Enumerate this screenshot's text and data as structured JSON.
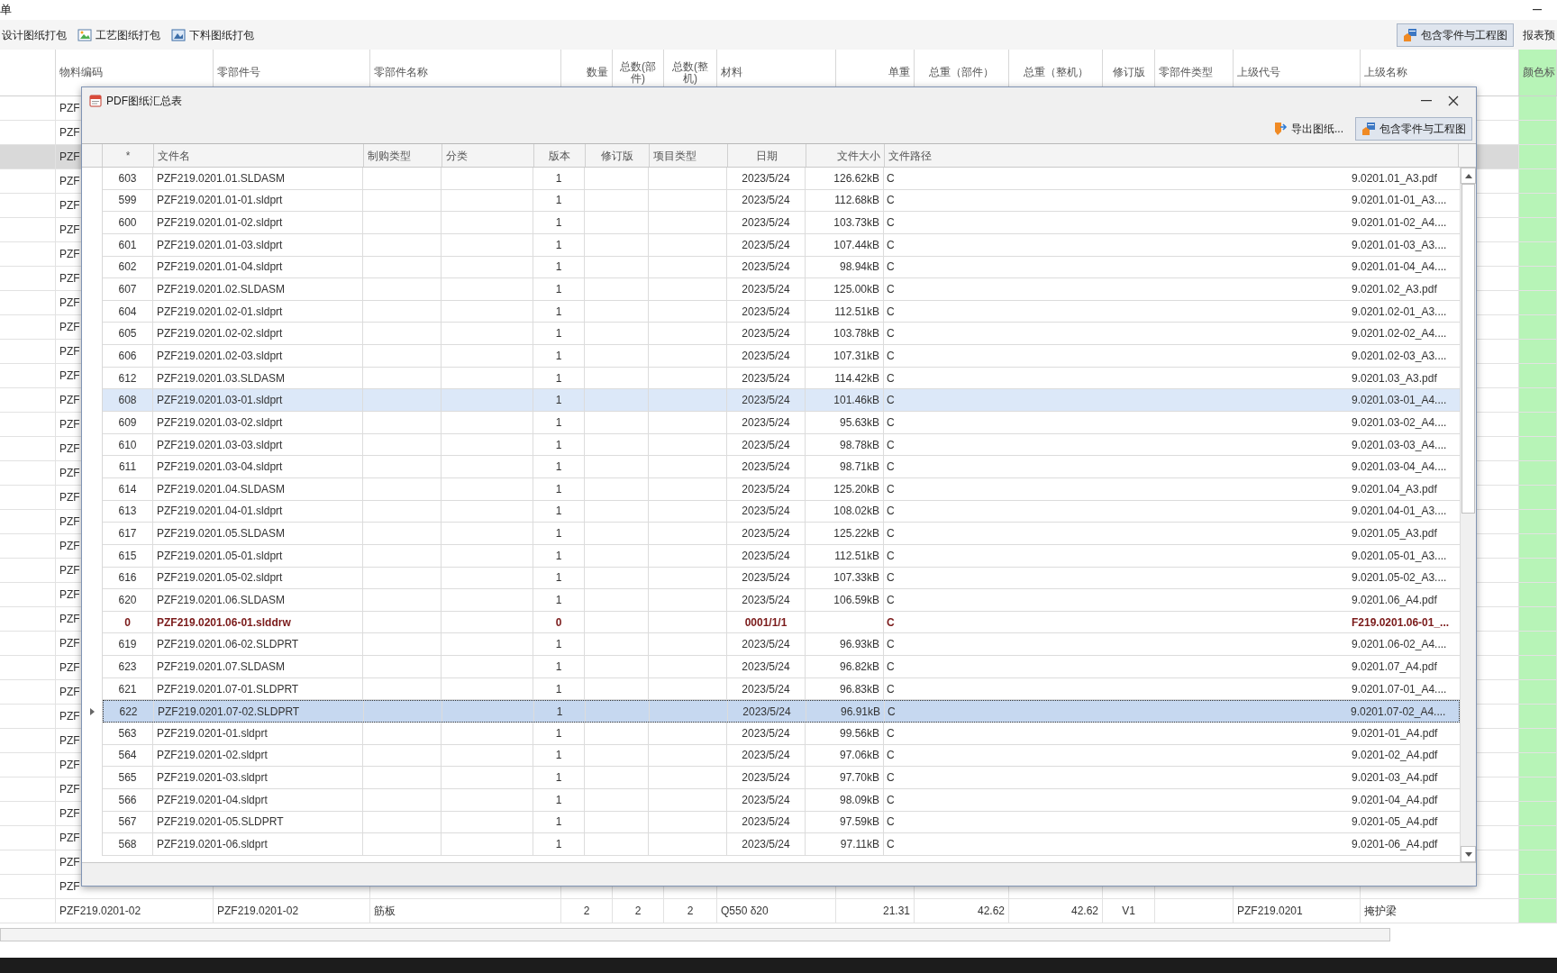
{
  "window": {
    "title": "单"
  },
  "toolbar": {
    "buttons": [
      {
        "label": "设计图纸打包",
        "kind": "text"
      },
      {
        "label": "工艺图纸打包",
        "kind": "process"
      },
      {
        "label": "下料图纸打包",
        "kind": "cutting"
      }
    ],
    "right": [
      {
        "label": "包含零件与工程图",
        "pressed": true
      },
      {
        "label": "报表预",
        "pressed": false
      }
    ]
  },
  "table": {
    "columns": [
      "物料编码",
      "零部件号",
      "零部件名称",
      "数量",
      "总数(部件)",
      "总数(整机)",
      "材料",
      "单重",
      "总重（部件）",
      "总重（整机）",
      "修订版",
      "零部件类型",
      "上级代号",
      "上级名称",
      "颜色标"
    ],
    "rows": [
      {
        "cells": [
          "PZF"
        ],
        "selected": false
      },
      {
        "cells": [
          "PZF"
        ],
        "selected": false
      },
      {
        "cells": [
          "PZF"
        ],
        "selected": true
      },
      {
        "cells": [
          "PZF"
        ],
        "selected": false
      },
      {
        "cells": [
          "PZF"
        ],
        "selected": false
      },
      {
        "cells": [
          "PZF"
        ],
        "selected": false
      },
      {
        "cells": [
          "PZF"
        ],
        "selected": false
      },
      {
        "cells": [
          "PZF"
        ],
        "selected": false
      },
      {
        "cells": [
          "PZF"
        ],
        "selected": false
      },
      {
        "cells": [
          "PZF"
        ],
        "selected": false
      },
      {
        "cells": [
          "PZF"
        ],
        "selected": false
      },
      {
        "cells": [
          "PZF"
        ],
        "selected": false
      },
      {
        "cells": [
          "PZF"
        ],
        "selected": false
      },
      {
        "cells": [
          "PZF"
        ],
        "selected": false
      },
      {
        "cells": [
          "PZF"
        ],
        "selected": false
      },
      {
        "cells": [
          "PZF"
        ],
        "selected": false
      },
      {
        "cells": [
          "PZF"
        ],
        "selected": false
      },
      {
        "cells": [
          "PZF"
        ],
        "selected": false
      },
      {
        "cells": [
          "PZF"
        ],
        "selected": false
      },
      {
        "cells": [
          "PZF"
        ],
        "selected": false
      },
      {
        "cells": [
          "PZF"
        ],
        "selected": false
      },
      {
        "cells": [
          "PZF"
        ],
        "selected": false
      },
      {
        "cells": [
          "PZF"
        ],
        "selected": false
      },
      {
        "cells": [
          "PZF"
        ],
        "selected": false
      },
      {
        "cells": [
          "PZF"
        ],
        "selected": false
      },
      {
        "cells": [
          "PZF"
        ],
        "selected": false
      },
      {
        "cells": [
          "PZF"
        ],
        "selected": false
      },
      {
        "cells": [
          "PZF"
        ],
        "selected": false
      },
      {
        "cells": [
          "PZF"
        ],
        "selected": false
      },
      {
        "cells": [
          "PZF"
        ],
        "selected": false
      },
      {
        "cells": [
          "PZF"
        ],
        "selected": false
      },
      {
        "cells": [
          "PZF"
        ],
        "selected": false
      },
      {
        "cells": [
          "PZF"
        ],
        "selected": false
      },
      {
        "cells": [
          "PZF219.0201-02",
          "PZF219.0201-02",
          "筋板",
          "2",
          "2",
          "2",
          "Q550 δ20",
          "21.31",
          "42.62",
          "42.62",
          "V1",
          "",
          "PZF219.0201",
          "掩护梁"
        ],
        "selected": false
      }
    ]
  },
  "dialog": {
    "title": "PDF图纸汇总表",
    "toolbar": [
      {
        "label": "导出图纸...",
        "kind": "export",
        "pressed": false
      },
      {
        "label": "包含零件与工程图",
        "kind": "include",
        "pressed": true
      }
    ],
    "columns": [
      "*",
      "文件名",
      "制购类型",
      "分类",
      "版本",
      "修订版",
      "项目类型",
      "日期",
      "文件大小",
      "文件路径"
    ],
    "rows": [
      {
        "no": "603",
        "file": "PZF219.0201.01.SLDASM",
        "version": "1",
        "date": "2023/5/24",
        "size": "126.62kB",
        "path": "C",
        "path_tail": "9.0201.01_A3.pdf",
        "kind": "normal",
        "selected": false,
        "current": false
      },
      {
        "no": "599",
        "file": "PZF219.0201.01-01.sldprt",
        "version": "1",
        "date": "2023/5/24",
        "size": "112.68kB",
        "path": "C",
        "path_tail": "9.0201.01-01_A3....",
        "kind": "normal",
        "selected": false,
        "current": false
      },
      {
        "no": "600",
        "file": "PZF219.0201.01-02.sldprt",
        "version": "1",
        "date": "2023/5/24",
        "size": "103.73kB",
        "path": "C",
        "path_tail": "9.0201.01-02_A4....",
        "kind": "normal",
        "selected": false,
        "current": false
      },
      {
        "no": "601",
        "file": "PZF219.0201.01-03.sldprt",
        "version": "1",
        "date": "2023/5/24",
        "size": "107.44kB",
        "path": "C",
        "path_tail": "9.0201.01-03_A3....",
        "kind": "normal",
        "selected": false,
        "current": false
      },
      {
        "no": "602",
        "file": "PZF219.0201.01-04.sldprt",
        "version": "1",
        "date": "2023/5/24",
        "size": "98.94kB",
        "path": "C",
        "path_tail": "9.0201.01-04_A4....",
        "kind": "normal",
        "selected": false,
        "current": false
      },
      {
        "no": "607",
        "file": "PZF219.0201.02.SLDASM",
        "version": "1",
        "date": "2023/5/24",
        "size": "125.00kB",
        "path": "C",
        "path_tail": "9.0201.02_A3.pdf",
        "kind": "normal",
        "selected": false,
        "current": false
      },
      {
        "no": "604",
        "file": "PZF219.0201.02-01.sldprt",
        "version": "1",
        "date": "2023/5/24",
        "size": "112.51kB",
        "path": "C",
        "path_tail": "9.0201.02-01_A3....",
        "kind": "normal",
        "selected": false,
        "current": false
      },
      {
        "no": "605",
        "file": "PZF219.0201.02-02.sldprt",
        "version": "1",
        "date": "2023/5/24",
        "size": "103.78kB",
        "path": "C",
        "path_tail": "9.0201.02-02_A4....",
        "kind": "normal",
        "selected": false,
        "current": false
      },
      {
        "no": "606",
        "file": "PZF219.0201.02-03.sldprt",
        "version": "1",
        "date": "2023/5/24",
        "size": "107.31kB",
        "path": "C",
        "path_tail": "9.0201.02-03_A3....",
        "kind": "normal",
        "selected": false,
        "current": false
      },
      {
        "no": "612",
        "file": "PZF219.0201.03.SLDASM",
        "version": "1",
        "date": "2023/5/24",
        "size": "114.42kB",
        "path": "C",
        "path_tail": "9.0201.03_A3.pdf",
        "kind": "normal",
        "selected": false,
        "current": false
      },
      {
        "no": "608",
        "file": "PZF219.0201.03-01.sldprt",
        "version": "1",
        "date": "2023/5/24",
        "size": "101.46kB",
        "path": "C",
        "path_tail": "9.0201.03-01_A4....",
        "kind": "normal",
        "selected": true,
        "current": false
      },
      {
        "no": "609",
        "file": "PZF219.0201.03-02.sldprt",
        "version": "1",
        "date": "2023/5/24",
        "size": "95.63kB",
        "path": "C",
        "path_tail": "9.0201.03-02_A4....",
        "kind": "normal",
        "selected": false,
        "current": false
      },
      {
        "no": "610",
        "file": "PZF219.0201.03-03.sldprt",
        "version": "1",
        "date": "2023/5/24",
        "size": "98.78kB",
        "path": "C",
        "path_tail": "9.0201.03-03_A4....",
        "kind": "normal",
        "selected": false,
        "current": false
      },
      {
        "no": "611",
        "file": "PZF219.0201.03-04.sldprt",
        "version": "1",
        "date": "2023/5/24",
        "size": "98.71kB",
        "path": "C",
        "path_tail": "9.0201.03-04_A4....",
        "kind": "normal",
        "selected": false,
        "current": false
      },
      {
        "no": "614",
        "file": "PZF219.0201.04.SLDASM",
        "version": "1",
        "date": "2023/5/24",
        "size": "125.20kB",
        "path": "C",
        "path_tail": "9.0201.04_A3.pdf",
        "kind": "normal",
        "selected": false,
        "current": false
      },
      {
        "no": "613",
        "file": "PZF219.0201.04-01.sldprt",
        "version": "1",
        "date": "2023/5/24",
        "size": "108.02kB",
        "path": "C",
        "path_tail": "9.0201.04-01_A3....",
        "kind": "normal",
        "selected": false,
        "current": false
      },
      {
        "no": "617",
        "file": "PZF219.0201.05.SLDASM",
        "version": "1",
        "date": "2023/5/24",
        "size": "125.22kB",
        "path": "C",
        "path_tail": "9.0201.05_A3.pdf",
        "kind": "normal",
        "selected": false,
        "current": false
      },
      {
        "no": "615",
        "file": "PZF219.0201.05-01.sldprt",
        "version": "1",
        "date": "2023/5/24",
        "size": "112.51kB",
        "path": "C",
        "path_tail": "9.0201.05-01_A3....",
        "kind": "normal",
        "selected": false,
        "current": false
      },
      {
        "no": "616",
        "file": "PZF219.0201.05-02.sldprt",
        "version": "1",
        "date": "2023/5/24",
        "size": "107.33kB",
        "path": "C",
        "path_tail": "9.0201.05-02_A3....",
        "kind": "normal",
        "selected": false,
        "current": false
      },
      {
        "no": "620",
        "file": "PZF219.0201.06.SLDASM",
        "version": "1",
        "date": "2023/5/24",
        "size": "106.59kB",
        "path": "C",
        "path_tail": "9.0201.06_A4.pdf",
        "kind": "normal",
        "selected": false,
        "current": false
      },
      {
        "no": "0",
        "file": "PZF219.0201.06-01.slddrw",
        "version": "0",
        "date": "0001/1/1",
        "path": "C",
        "path_tail": "F219.0201.06-01_...",
        "kind": "missing",
        "selected": false,
        "current": false
      },
      {
        "no": "619",
        "file": "PZF219.0201.06-02.SLDPRT",
        "version": "1",
        "date": "2023/5/24",
        "size": "96.93kB",
        "path": "C",
        "path_tail": "9.0201.06-02_A4....",
        "kind": "normal",
        "selected": false,
        "current": false
      },
      {
        "no": "623",
        "file": "PZF219.0201.07.SLDASM",
        "version": "1",
        "date": "2023/5/24",
        "size": "96.82kB",
        "path": "C",
        "path_tail": "9.0201.07_A4.pdf",
        "kind": "normal",
        "selected": false,
        "current": false
      },
      {
        "no": "621",
        "file": "PZF219.0201.07-01.SLDPRT",
        "version": "1",
        "date": "2023/5/24",
        "size": "96.83kB",
        "path": "C",
        "path_tail": "9.0201.07-01_A4....",
        "kind": "normal",
        "selected": false,
        "current": false
      },
      {
        "no": "622",
        "file": "PZF219.0201.07-02.SLDPRT",
        "version": "1",
        "date": "2023/5/24",
        "size": "96.91kB",
        "path": "C",
        "path_tail": "9.0201.07-02_A4....",
        "kind": "normal",
        "selected": true,
        "current": true
      },
      {
        "no": "563",
        "file": "PZF219.0201-01.sldprt",
        "version": "1",
        "date": "2023/5/24",
        "size": "99.56kB",
        "path": "C",
        "path_tail": "9.0201-01_A4.pdf",
        "kind": "normal",
        "selected": false,
        "current": false
      },
      {
        "no": "564",
        "file": "PZF219.0201-02.sldprt",
        "version": "1",
        "date": "2023/5/24",
        "size": "97.06kB",
        "path": "C",
        "path_tail": "9.0201-02_A4.pdf",
        "kind": "normal",
        "selected": false,
        "current": false
      },
      {
        "no": "565",
        "file": "PZF219.0201-03.sldprt",
        "version": "1",
        "date": "2023/5/24",
        "size": "97.70kB",
        "path": "C",
        "path_tail": "9.0201-03_A4.pdf",
        "kind": "normal",
        "selected": false,
        "current": false
      },
      {
        "no": "566",
        "file": "PZF219.0201-04.sldprt",
        "version": "1",
        "date": "2023/5/24",
        "size": "98.09kB",
        "path": "C",
        "path_tail": "9.0201-04_A4.pdf",
        "kind": "normal",
        "selected": false,
        "current": false
      },
      {
        "no": "567",
        "file": "PZF219.0201-05.SLDPRT",
        "version": "1",
        "date": "2023/5/24",
        "size": "97.59kB",
        "path": "C",
        "path_tail": "9.0201-05_A4.pdf",
        "kind": "normal",
        "selected": false,
        "current": false
      },
      {
        "no": "568",
        "file": "PZF219.0201-06.sldprt",
        "version": "1",
        "date": "2023/5/24",
        "size": "97.11kB",
        "path": "C",
        "path_tail": "9.0201-06_A4.pdf",
        "kind": "normal",
        "selected": false,
        "current": false
      }
    ]
  }
}
